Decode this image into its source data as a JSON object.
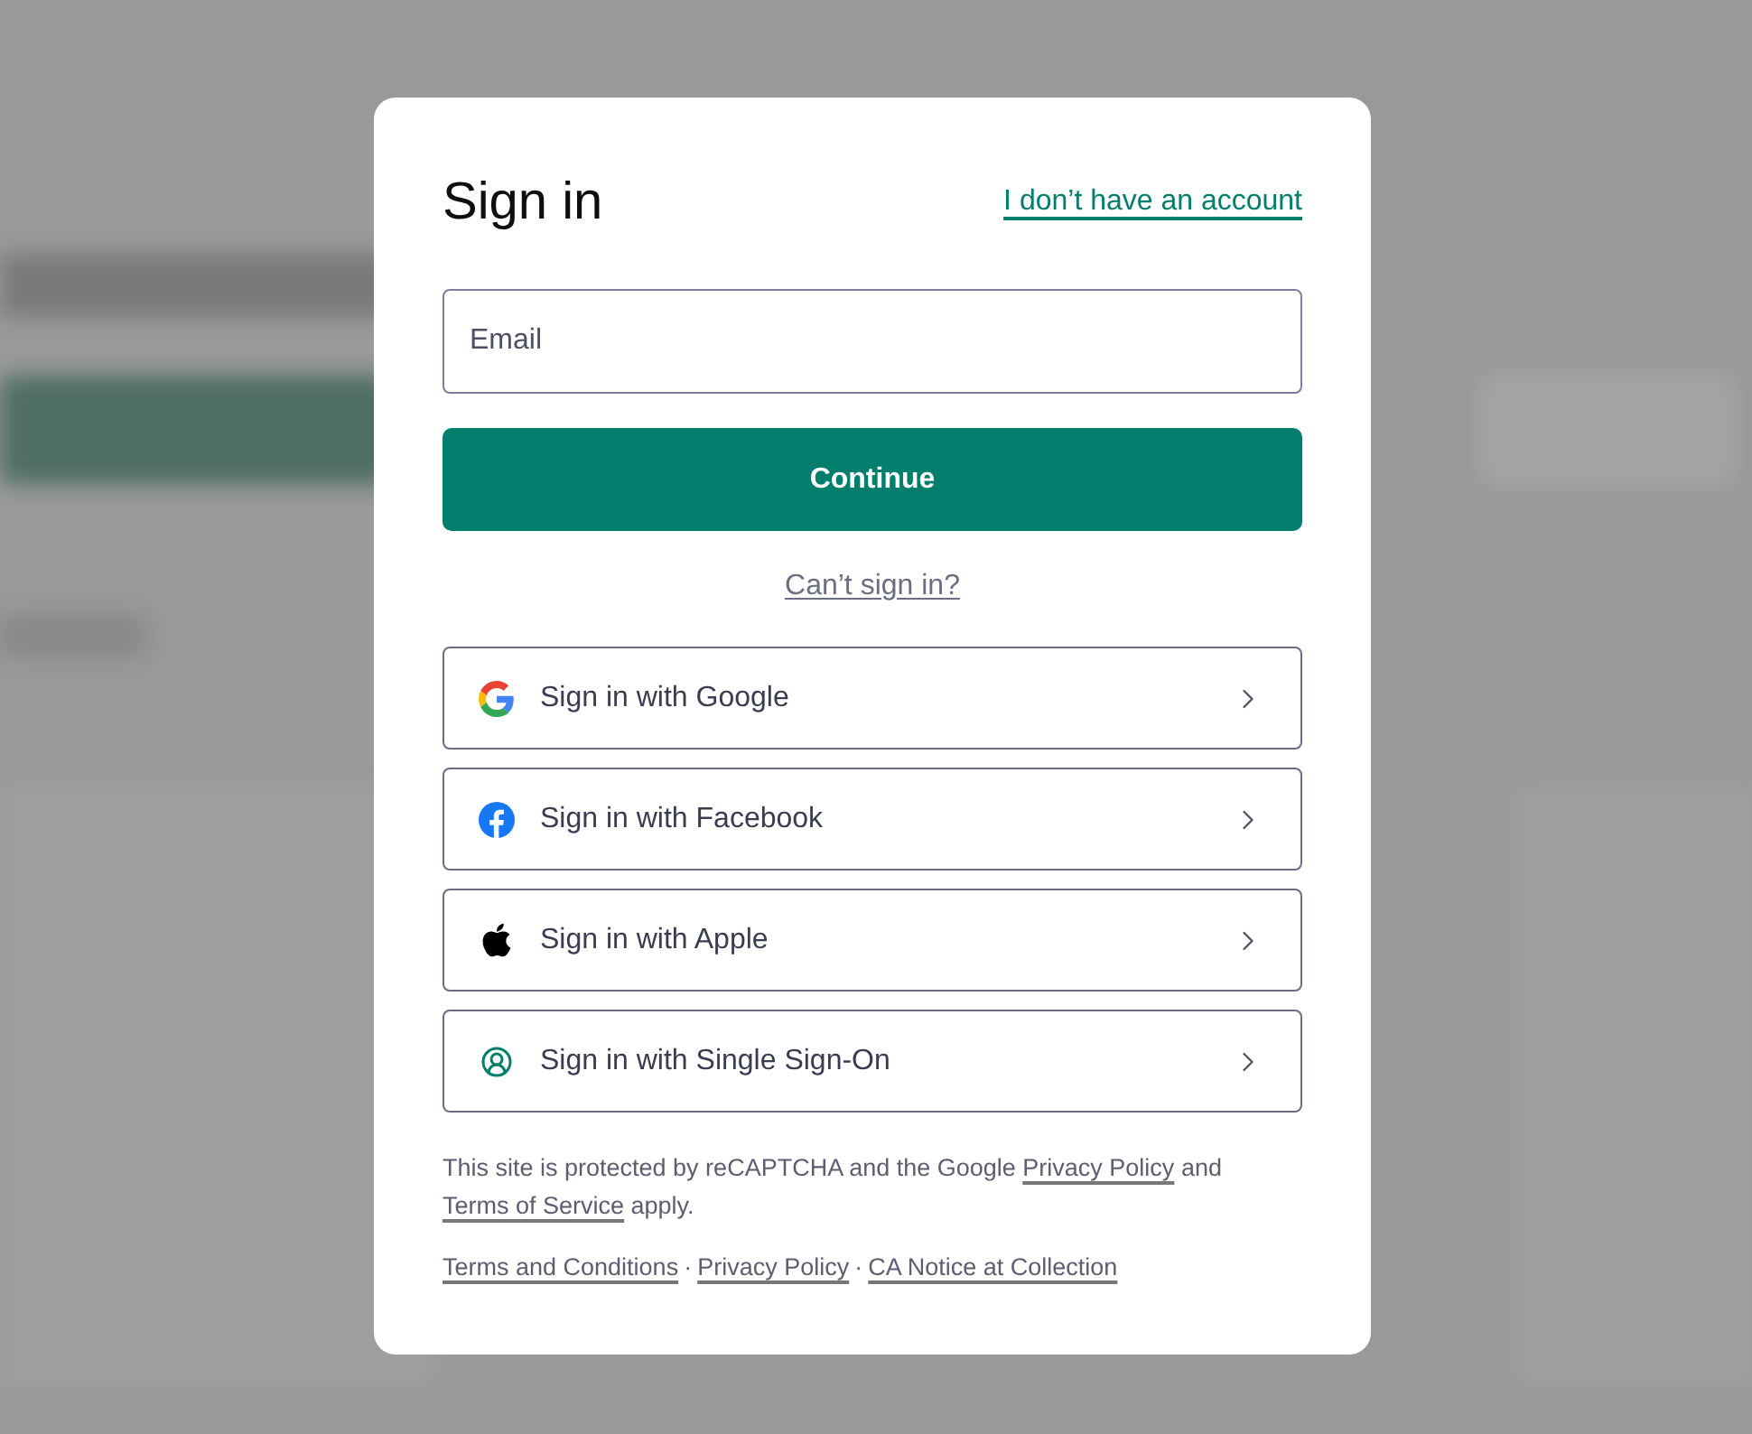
{
  "dialog": {
    "title": "Sign in",
    "account_link": "I don’t have an account",
    "email": {
      "placeholder": "Email"
    },
    "continue_button": "Continue",
    "cant_sign_in_link": "Can’t sign in?",
    "providers": [
      {
        "kind": "google",
        "label": "Sign in with Google"
      },
      {
        "kind": "facebook",
        "label": "Sign in with Facebook"
      },
      {
        "kind": "apple",
        "label": "Sign in with Apple"
      },
      {
        "kind": "sso",
        "label": "Sign in with Single Sign-On"
      }
    ],
    "legal_text": [
      {
        "kind": "text",
        "text": "This site is protected by reCAPTCHA and the Google "
      },
      {
        "kind": "link",
        "text": "Privacy Policy"
      },
      {
        "kind": "text",
        "text": " and "
      },
      {
        "kind": "link",
        "text": "Terms of Service"
      },
      {
        "kind": "text",
        "text": " apply."
      }
    ],
    "footer_links": [
      "Terms and Conditions",
      "Privacy Policy",
      "CA Notice at Collection"
    ],
    "footer_separator": "·"
  }
}
